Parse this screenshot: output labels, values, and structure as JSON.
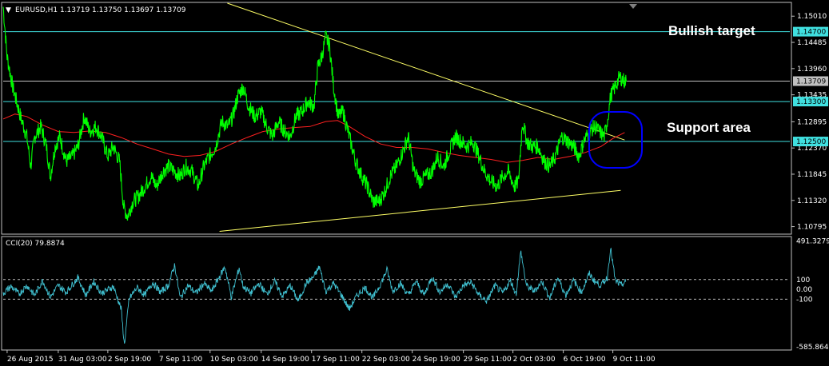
{
  "chart_data": [
    {
      "type": "line",
      "title": "EURUSD,H1  1.13719 1.13750 1.13697 1.13709",
      "ylim": [
        1.1066,
        1.1527
      ],
      "y_ticks": [
        "1.15010",
        "1.14485",
        "1.13960",
        "1.13435",
        "1.12895",
        "1.12370",
        "1.11845",
        "1.11320",
        "1.10795"
      ],
      "y_tick_values": [
        1.1501,
        1.14485,
        1.1396,
        1.13435,
        1.12895,
        1.1237,
        1.11845,
        1.1132,
        1.10795
      ],
      "x_labels": [
        "26 Aug 2015",
        "31 Aug 03:00",
        "2 Sep 19:00",
        "7 Sep 11:00",
        "10 Sep 03:00",
        "14 Sep 19:00",
        "17 Sep 11:00",
        "22 Sep 03:00",
        "24 Sep 19:00",
        "29 Sep 11:00",
        "2 Oct 03:00",
        "6 Oct 19:00",
        "9 Oct 11:00"
      ],
      "x_range": [
        0,
        1000
      ],
      "x_label_pos": [
        5,
        70,
        133,
        198,
        263,
        328,
        392,
        456,
        520,
        585,
        648,
        712,
        775
      ],
      "price_key": [
        [
          0,
          1.152
        ],
        [
          5,
          1.142
        ],
        [
          12,
          1.136
        ],
        [
          22,
          1.13
        ],
        [
          30,
          1.126
        ],
        [
          35,
          1.12
        ],
        [
          40,
          1.126
        ],
        [
          48,
          1.128
        ],
        [
          55,
          1.124
        ],
        [
          60,
          1.118
        ],
        [
          66,
          1.124
        ],
        [
          72,
          1.126
        ],
        [
          80,
          1.121
        ],
        [
          88,
          1.122
        ],
        [
          95,
          1.124
        ],
        [
          103,
          1.13
        ],
        [
          110,
          1.127
        ],
        [
          118,
          1.128
        ],
        [
          125,
          1.126
        ],
        [
          133,
          1.122
        ],
        [
          140,
          1.124
        ],
        [
          148,
          1.121
        ],
        [
          153,
          1.112
        ],
        [
          158,
          1.11
        ],
        [
          165,
          1.113
        ],
        [
          172,
          1.114
        ],
        [
          180,
          1.116
        ],
        [
          188,
          1.118
        ],
        [
          195,
          1.116
        ],
        [
          203,
          1.119
        ],
        [
          210,
          1.12
        ],
        [
          218,
          1.119
        ],
        [
          225,
          1.118
        ],
        [
          232,
          1.12
        ],
        [
          240,
          1.119
        ],
        [
          248,
          1.116
        ],
        [
          255,
          1.12
        ],
        [
          262,
          1.122
        ],
        [
          270,
          1.124
        ],
        [
          278,
          1.129
        ],
        [
          286,
          1.128
        ],
        [
          292,
          1.13
        ],
        [
          298,
          1.134
        ],
        [
          305,
          1.136
        ],
        [
          312,
          1.132
        ],
        [
          320,
          1.13
        ],
        [
          328,
          1.131
        ],
        [
          335,
          1.128
        ],
        [
          342,
          1.126
        ],
        [
          350,
          1.129
        ],
        [
          358,
          1.127
        ],
        [
          365,
          1.126
        ],
        [
          372,
          1.13
        ],
        [
          380,
          1.131
        ],
        [
          387,
          1.133
        ],
        [
          395,
          1.132
        ],
        [
          400,
          1.14
        ],
        [
          405,
          1.142
        ],
        [
          410,
          1.146
        ],
        [
          415,
          1.144
        ],
        [
          420,
          1.136
        ],
        [
          426,
          1.13
        ],
        [
          432,
          1.131
        ],
        [
          440,
          1.126
        ],
        [
          448,
          1.121
        ],
        [
          456,
          1.118
        ],
        [
          463,
          1.116
        ],
        [
          470,
          1.113
        ],
        [
          478,
          1.113
        ],
        [
          485,
          1.115
        ],
        [
          492,
          1.118
        ],
        [
          500,
          1.12
        ],
        [
          508,
          1.123
        ],
        [
          515,
          1.126
        ],
        [
          522,
          1.119
        ],
        [
          530,
          1.117
        ],
        [
          537,
          1.118
        ],
        [
          545,
          1.119
        ],
        [
          552,
          1.122
        ],
        [
          560,
          1.12
        ],
        [
          567,
          1.123
        ],
        [
          575,
          1.126
        ],
        [
          582,
          1.125
        ],
        [
          590,
          1.124
        ],
        [
          597,
          1.125
        ],
        [
          605,
          1.122
        ],
        [
          612,
          1.119
        ],
        [
          620,
          1.117
        ],
        [
          628,
          1.116
        ],
        [
          635,
          1.118
        ],
        [
          642,
          1.119
        ],
        [
          650,
          1.116
        ],
        [
          655,
          1.117
        ],
        [
          660,
          1.129
        ],
        [
          666,
          1.125
        ],
        [
          672,
          1.124
        ],
        [
          680,
          1.124
        ],
        [
          688,
          1.121
        ],
        [
          695,
          1.12
        ],
        [
          702,
          1.122
        ],
        [
          710,
          1.126
        ],
        [
          718,
          1.125
        ],
        [
          725,
          1.124
        ],
        [
          732,
          1.122
        ],
        [
          738,
          1.125
        ],
        [
          745,
          1.127
        ],
        [
          752,
          1.128
        ],
        [
          758,
          1.127
        ],
        [
          764,
          1.126
        ],
        [
          768,
          1.129
        ],
        [
          772,
          1.134
        ],
        [
          778,
          1.136
        ],
        [
          784,
          1.138
        ],
        [
          790,
          1.137
        ],
        [
          793,
          1.1371
        ]
      ],
      "ma_key": [
        [
          0,
          1.1295
        ],
        [
          15,
          1.1305
        ],
        [
          30,
          1.13
        ],
        [
          50,
          1.1283
        ],
        [
          70,
          1.127
        ],
        [
          90,
          1.1268
        ],
        [
          110,
          1.1271
        ],
        [
          130,
          1.1268
        ],
        [
          150,
          1.1258
        ],
        [
          170,
          1.1245
        ],
        [
          190,
          1.1235
        ],
        [
          210,
          1.1225
        ],
        [
          230,
          1.122
        ],
        [
          250,
          1.1222
        ],
        [
          270,
          1.123
        ],
        [
          290,
          1.1245
        ],
        [
          310,
          1.1258
        ],
        [
          330,
          1.127
        ],
        [
          350,
          1.1275
        ],
        [
          370,
          1.1278
        ],
        [
          390,
          1.128
        ],
        [
          410,
          1.129
        ],
        [
          425,
          1.1292
        ],
        [
          440,
          1.128
        ],
        [
          460,
          1.126
        ],
        [
          480,
          1.1245
        ],
        [
          500,
          1.1238
        ],
        [
          520,
          1.1238
        ],
        [
          540,
          1.1235
        ],
        [
          560,
          1.1228
        ],
        [
          580,
          1.1222
        ],
        [
          600,
          1.1218
        ],
        [
          620,
          1.1214
        ],
        [
          640,
          1.1208
        ],
        [
          660,
          1.1212
        ],
        [
          680,
          1.1218
        ],
        [
          700,
          1.1214
        ],
        [
          720,
          1.122
        ],
        [
          740,
          1.1228
        ],
        [
          760,
          1.124
        ],
        [
          775,
          1.1256
        ],
        [
          790,
          1.1268
        ]
      ],
      "series": [],
      "horizontal_levels": [
        {
          "value": 1.147,
          "label": "1.14700",
          "color": "#40e0e0"
        },
        {
          "value": 1.13709,
          "label": "1.13709",
          "color": "#c0c0c0"
        },
        {
          "value": 1.133,
          "label": "1.13300",
          "color": "#40e0e0"
        },
        {
          "value": 1.125,
          "label": "1.12500",
          "color": "#40e0e0"
        }
      ],
      "trendlines": [
        {
          "x1": 285,
          "y1": 1.1527,
          "x2": 790,
          "y2": 1.1253,
          "color": "#ffff66"
        },
        {
          "x1": 275,
          "y1": 1.107,
          "x2": 785,
          "y2": 1.1152,
          "color": "#ffff66"
        }
      ],
      "annotations": [
        {
          "text": "Bullish target"
        },
        {
          "text": "Support area"
        }
      ],
      "colors": {
        "price": "#00ff00",
        "ma": "#ff2020",
        "ellipse": "#0000ff"
      }
    },
    {
      "type": "line",
      "title": "CCI(20) 79.8874",
      "ylim": [
        -610,
        530
      ],
      "y_ticks": [
        "491.3279",
        "100",
        "0.00",
        "-100",
        "-585.8642"
      ],
      "y_tick_values": [
        491.3279,
        100,
        0,
        -100,
        -585.8642
      ],
      "levels": [
        100,
        -100
      ],
      "cci_key": [
        [
          0,
          -40
        ],
        [
          10,
          30
        ],
        [
          20,
          -50
        ],
        [
          30,
          40
        ],
        [
          40,
          -60
        ],
        [
          50,
          90
        ],
        [
          60,
          -80
        ],
        [
          70,
          40
        ],
        [
          80,
          -30
        ],
        [
          95,
          120
        ],
        [
          105,
          -60
        ],
        [
          115,
          80
        ],
        [
          125,
          -40
        ],
        [
          140,
          30
        ],
        [
          150,
          -200
        ],
        [
          154,
          -570
        ],
        [
          160,
          -100
        ],
        [
          170,
          20
        ],
        [
          180,
          -60
        ],
        [
          190,
          70
        ],
        [
          200,
          -30
        ],
        [
          210,
          40
        ],
        [
          218,
          250
        ],
        [
          225,
          -90
        ],
        [
          235,
          40
        ],
        [
          245,
          -40
        ],
        [
          255,
          60
        ],
        [
          265,
          -20
        ],
        [
          275,
          130
        ],
        [
          282,
          230
        ],
        [
          290,
          -80
        ],
        [
          300,
          220
        ],
        [
          305,
          30
        ],
        [
          315,
          -40
        ],
        [
          325,
          60
        ],
        [
          335,
          -50
        ],
        [
          345,
          80
        ],
        [
          355,
          -70
        ],
        [
          365,
          40
        ],
        [
          375,
          -120
        ],
        [
          385,
          60
        ],
        [
          395,
          130
        ],
        [
          402,
          230
        ],
        [
          410,
          -20
        ],
        [
          420,
          60
        ],
        [
          430,
          -60
        ],
        [
          440,
          -200
        ],
        [
          450,
          -60
        ],
        [
          460,
          20
        ],
        [
          470,
          -90
        ],
        [
          480,
          60
        ],
        [
          488,
          200
        ],
        [
          495,
          -20
        ],
        [
          505,
          60
        ],
        [
          515,
          -60
        ],
        [
          525,
          80
        ],
        [
          535,
          -60
        ],
        [
          545,
          130
        ],
        [
          555,
          -30
        ],
        [
          565,
          60
        ],
        [
          575,
          -80
        ],
        [
          585,
          40
        ],
        [
          595,
          70
        ],
        [
          605,
          -60
        ],
        [
          615,
          -120
        ],
        [
          625,
          40
        ],
        [
          635,
          -40
        ],
        [
          645,
          90
        ],
        [
          652,
          -50
        ],
        [
          658,
          390
        ],
        [
          665,
          40
        ],
        [
          675,
          -20
        ],
        [
          685,
          80
        ],
        [
          695,
          -90
        ],
        [
          705,
          120
        ],
        [
          715,
          -60
        ],
        [
          725,
          90
        ],
        [
          735,
          -30
        ],
        [
          745,
          160
        ],
        [
          752,
          80
        ],
        [
          760,
          40
        ],
        [
          768,
          120
        ],
        [
          772,
          430
        ],
        [
          778,
          90
        ],
        [
          785,
          40
        ],
        [
          792,
          79.9
        ]
      ],
      "colors": {
        "cci": "#40c0d0"
      }
    }
  ],
  "window": {
    "hdr_arrow": "▼",
    "title": "EURUSD,H1  1.13719 1.13750 1.13697 1.13709",
    "subtitle": "CCI(20) 79.8874"
  }
}
